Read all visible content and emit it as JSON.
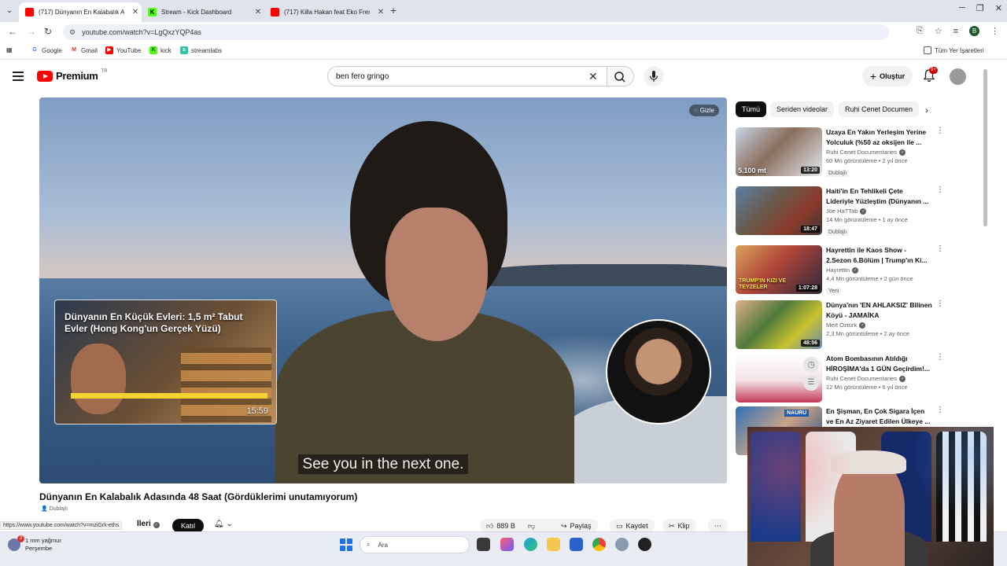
{
  "browser": {
    "tabs": [
      {
        "title": "(717) Dünyanın En Kalabalık Ad",
        "icon": "youtube-icon",
        "active": true
      },
      {
        "title": "Stream - Kick Dashboard",
        "icon": "kick-icon",
        "active": false
      },
      {
        "title": "(717) Killa Hakan feat Eko Fresh",
        "icon": "youtube-icon",
        "active": false
      }
    ],
    "url": "youtube.com/watch?v=LgQxzYQP4as",
    "profile_letter": "B",
    "bookmarks": [
      {
        "label": "Google",
        "icon": "google-icon"
      },
      {
        "label": "Gmail",
        "icon": "gmail-icon"
      },
      {
        "label": "YouTube",
        "icon": "youtube-icon"
      },
      {
        "label": "kick",
        "icon": "kick-icon"
      },
      {
        "label": "streamlabs",
        "icon": "streamlabs-icon"
      }
    ],
    "all_bookmarks_label": "Tüm Yer İşaretleri",
    "status_url": "https://www.youtube.com/watch?v=mziGrk-eths"
  },
  "header": {
    "logo_text": "Premium",
    "logo_region": "TR",
    "search_query": "ben fero gringo",
    "create_label": "Oluştur",
    "notification_count": "9+"
  },
  "player": {
    "hide_label": "Gizle",
    "subtitle": "See you in the next one.",
    "endcard": {
      "title": "Dünyanın En Küçük Evleri: 1,5 m² Tabut Evler (Hong Kong'un Gerçek Yüzü)",
      "duration": "15:59"
    }
  },
  "video": {
    "title": "Dünyanın En Kalabalık Adasında 48 Saat (Gördüklerimi unutamıyorum)",
    "dubbed_label": "Dublajlı",
    "channel_name_partial": "lleri",
    "join_label": "Katıl",
    "likes": "889 B",
    "share_label": "Paylaş",
    "save_label": "Kaydet",
    "clip_label": "Klip"
  },
  "sidebar": {
    "chips": [
      "Tümü",
      "Seriden videolar",
      "Ruhi Cenet Documen"
    ],
    "recommendations": [
      {
        "title": "Uzaya En Yakın Yerleşim Yerine Yolculuk (%50 az oksijen ile ...",
        "channel": "Ruhi Cenet Documentaries",
        "verified": true,
        "meta": "60 Mn görüntüleme • 2 yıl önce",
        "badge": "Dublajlı",
        "duration": "13:20",
        "thumb_text": "5.100 mt"
      },
      {
        "title": "Haiti'in En Tehlikeli Çete Lideriyle Yüzleştim (Dünyanın ...",
        "channel": "Joe HaTTab",
        "verified": true,
        "meta": "14 Mn görüntüleme • 1 ay önce",
        "badge": "Dublajlı",
        "duration": "18:47",
        "thumb_text": ""
      },
      {
        "title": "Hayrettin ile Kaos Show - 2.Sezon 6.Bölüm | Trump'ın Ki...",
        "channel": "Hayrettin",
        "verified": true,
        "meta": "4,4 Mn görüntüleme • 2 gün önce",
        "badge": "Yeni",
        "duration": "1:07:28",
        "thumb_text": "TRUMP'IN KIZI VE TEYZELER"
      },
      {
        "title": "Dünya'nın 'EN AHLAKSIZ' Bilinen Köyü - JAMAİKA",
        "channel": "Mert Öztürk",
        "verified": true,
        "meta": "2,3 Mn görüntüleme • 2 ay önce",
        "badge": "",
        "duration": "48:56",
        "thumb_text": ""
      },
      {
        "title": "Atom Bombasının Atıldığı HİROŞİMA'da 1 GÜN Geçirdim!...",
        "channel": "Ruhi Cenet Documentaries",
        "verified": true,
        "meta": "12 Mn görüntüleme • 6 yıl önce",
        "badge": "",
        "duration": "",
        "thumb_text": ""
      },
      {
        "title": "En Şişman, En Çok Sigara İçen ve En Az Ziyaret Edilen Ülkeye ...",
        "channel": "",
        "verified": false,
        "meta": "",
        "badge": "",
        "duration": "",
        "thumb_text": "NAURU"
      }
    ]
  },
  "taskbar": {
    "weather_line1": "1 mm yağmur",
    "weather_line2": "Perşembe",
    "weather_badge": "3",
    "search_label": "Ara"
  },
  "colors": {
    "youtube_red": "#ff0000",
    "kick_green": "#53fc18",
    "chip_active": "#0f0f0f"
  }
}
